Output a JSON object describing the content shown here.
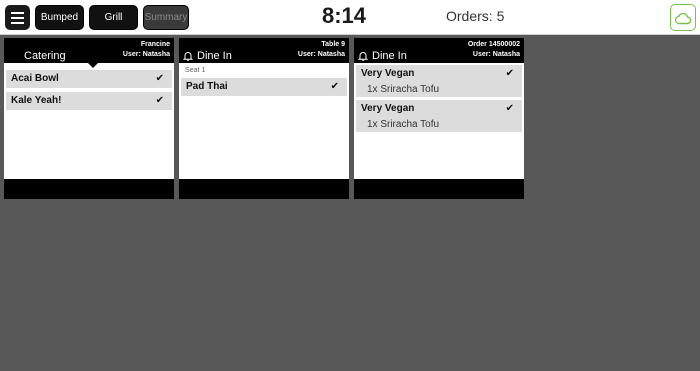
{
  "topbar": {
    "buttons": {
      "bumped": "Bumped",
      "grill": "Grill",
      "summary": "Summary"
    },
    "clock": "8:14",
    "orders": "Orders: 5"
  },
  "cards": [
    {
      "title": "Catering",
      "right_line1": "Francine",
      "right_line2": "User: Natasha",
      "items": [
        {
          "name": "Acai Bowl",
          "check": "✔"
        },
        {
          "name": "Kale Yeah!",
          "check": "✔"
        }
      ]
    },
    {
      "title": "Dine In",
      "right_line1": "Table 9",
      "right_line2": "User: Natasha",
      "seat": "Seat 1",
      "items": [
        {
          "name": "Pad Thai",
          "check": "✔"
        }
      ]
    },
    {
      "title": "Dine In",
      "right_line1": "Order 14500002",
      "right_line2": "User: Natasha",
      "items": [
        {
          "name": "Very Vegan",
          "modifier": "1x Sriracha Tofu",
          "check": "✔"
        },
        {
          "name": "Very Vegan",
          "modifier": "1x Sriracha Tofu",
          "check": "✔"
        }
      ]
    }
  ],
  "icons": {
    "menu": "hamburger-menu-icon",
    "cloud": "cloud-icon",
    "bell": "bell-icon",
    "check": "checkmark-icon"
  },
  "colors": {
    "background": "#585858",
    "cloud_accent": "#7cc24a",
    "item_highlight": "#dcdcdc"
  }
}
